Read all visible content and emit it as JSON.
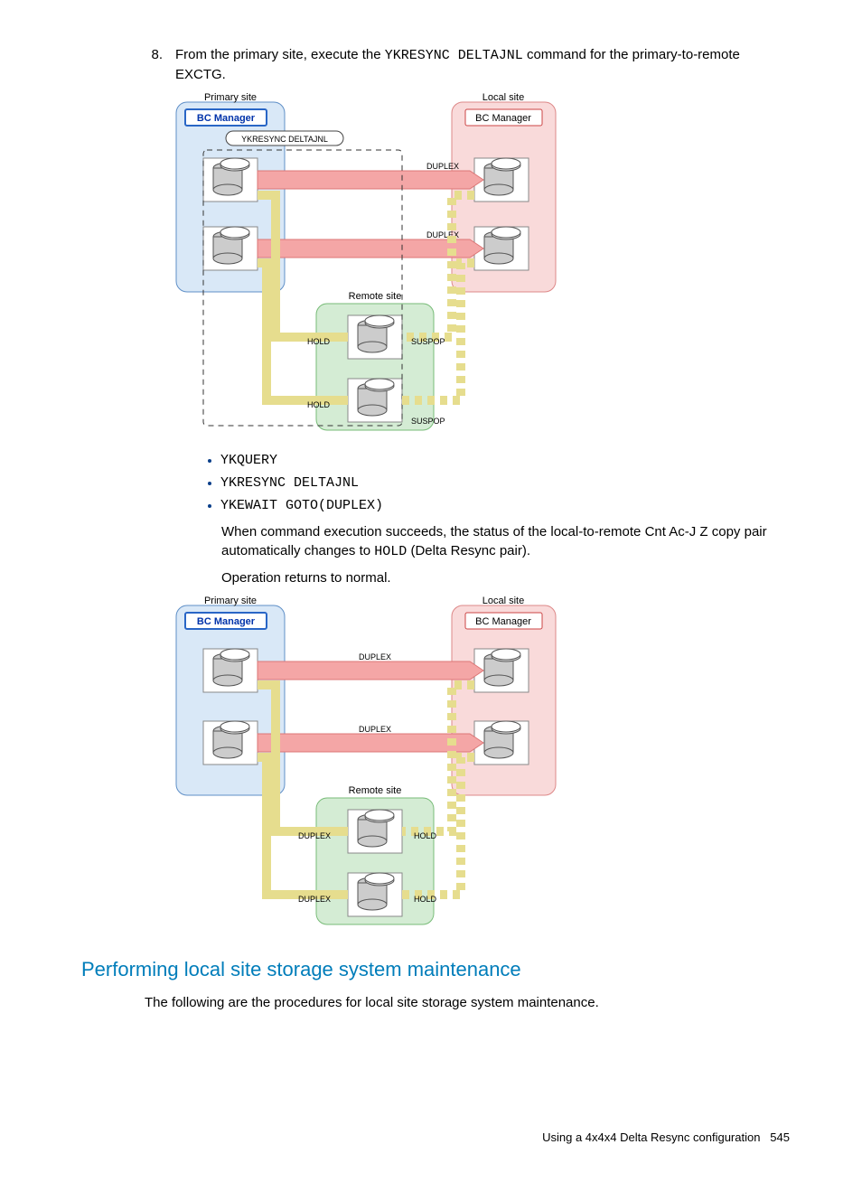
{
  "step": {
    "number": "8.",
    "text_a": "From the primary site, execute the ",
    "text_b": "YKRESYNC DELTAJNL",
    "text_c": " command for the primary-to-remote EXCTG."
  },
  "diagram1": {
    "primary_site": "Primary site",
    "local_site": "Local site",
    "remote_site": "Remote site",
    "bc_manager": "BC Manager",
    "ykresync": "YKRESYNC DELTAJNL",
    "duplex": "DUPLEX",
    "hold": "HOLD",
    "suspop": "SUSPOP"
  },
  "commands": {
    "c1": "YKQUERY",
    "c2": "YKRESYNC DELTAJNL",
    "c3": "YKEWAIT GOTO(DUPLEX)"
  },
  "result": {
    "part_a": "When command execution succeeds, the status of the local-to-remote Cnt Ac-J Z copy pair automatically changes to ",
    "part_b": "HOLD",
    "part_c": " (Delta Resync pair)."
  },
  "return_text": "Operation returns to normal.",
  "diagram2": {
    "primary_site": "Primary site",
    "local_site": "Local site",
    "remote_site": "Remote site",
    "bc_manager": "BC Manager",
    "duplex": "DUPLEX",
    "hold": "HOLD"
  },
  "section_heading": "Performing local site storage system maintenance",
  "section_text": "The following are the procedures for local site storage system maintenance.",
  "footer": {
    "label": "Using a 4x4x4 Delta Resync configuration",
    "page": "545"
  }
}
